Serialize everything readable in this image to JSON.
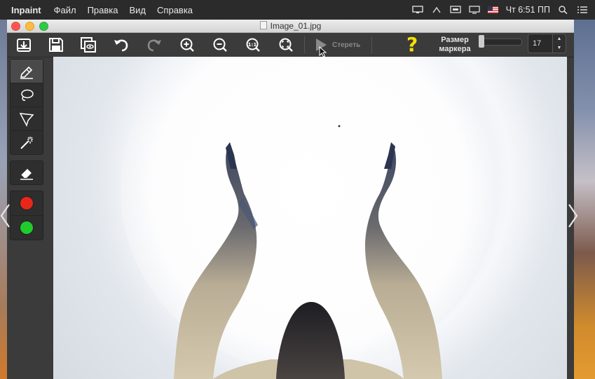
{
  "menubar": {
    "app_name": "Inpaint",
    "items": [
      "Файл",
      "Правка",
      "Вид",
      "Справка"
    ],
    "clock": "Чт 6:51 ПП"
  },
  "window": {
    "title": "Image_01.jpg"
  },
  "toolbar": {
    "erase_label": "Стереть",
    "help_label": "?",
    "size_label_line1": "Размер",
    "size_label_line2": "маркера",
    "marker_size": "17",
    "stepper_up": "▲",
    "stepper_down": "▼"
  },
  "colors": {
    "accent_yellow": "#f5e000",
    "marker_red": "#e8271a",
    "marker_green": "#1fcc2c"
  }
}
